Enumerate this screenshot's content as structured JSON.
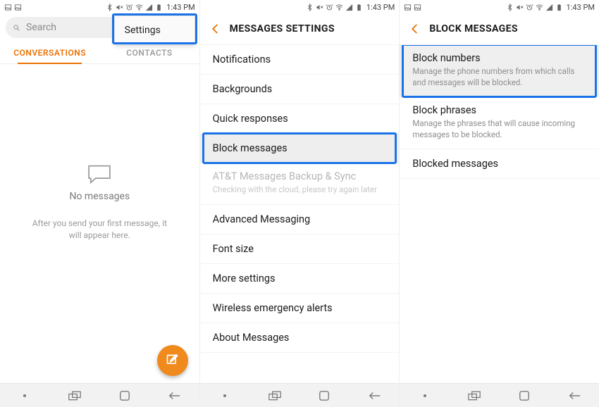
{
  "statusbar": {
    "time": "1:43 PM"
  },
  "screen1": {
    "search_placeholder": "Search",
    "tabs": {
      "conversations": "CONVERSATIONS",
      "contacts": "CONTACTS"
    },
    "menu": {
      "settings": "Settings"
    },
    "empty": {
      "title": "No messages",
      "subtitle": "After you send your first message, it will appear here."
    }
  },
  "screen2": {
    "title": "MESSAGES SETTINGS",
    "items": {
      "notifications": "Notifications",
      "backgrounds": "Backgrounds",
      "quick_responses": "Quick responses",
      "block_messages": "Block messages",
      "att_backup": "AT&T Messages Backup & Sync",
      "att_backup_sub": "Checking with the cloud, please try again later",
      "advanced": "Advanced Messaging",
      "font_size": "Font size",
      "more": "More settings",
      "wea": "Wireless emergency alerts",
      "about": "About Messages"
    }
  },
  "screen3": {
    "title": "BLOCK MESSAGES",
    "items": {
      "block_numbers": "Block numbers",
      "block_numbers_sub": "Manage the phone numbers from which calls and messages will be blocked.",
      "block_phrases": "Block phrases",
      "block_phrases_sub": "Manage the phrases that will cause incoming messages to be blocked.",
      "blocked_messages": "Blocked messages"
    }
  }
}
